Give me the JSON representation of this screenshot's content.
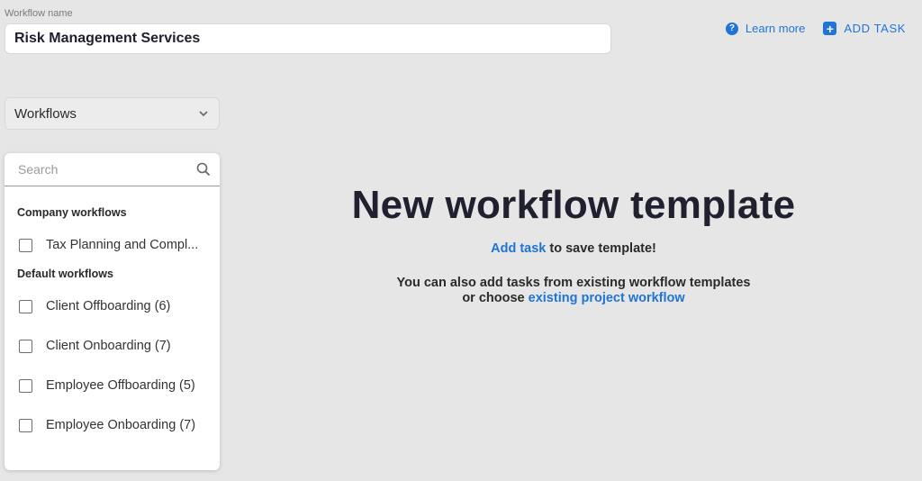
{
  "workflow": {
    "label": "Workflow name",
    "value": "Risk Management Services"
  },
  "actions": {
    "learn_more": "Learn more",
    "add_task": "ADD TASK"
  },
  "dropdown": {
    "selected": "Workflows"
  },
  "search": {
    "placeholder": "Search"
  },
  "groups": {
    "company": {
      "title": "Company workflows",
      "items": [
        "Tax Planning and Compl..."
      ]
    },
    "default": {
      "title": "Default workflows",
      "items": [
        "Client Offboarding (6)",
        "Client Onboarding (7)",
        "Employee Offboarding (5)",
        "Employee Onboarding (7)"
      ]
    }
  },
  "empty_state": {
    "title": "New workflow template",
    "add_task_link": "Add task",
    "add_task_suffix": " to save template!",
    "line2": "You can also add tasks from existing workflow templates",
    "line3_prefix": "or choose ",
    "line3_link": "existing project workflow"
  },
  "colors": {
    "accent": "#1f74d6",
    "background": "#e6e6e6"
  },
  "icons": [
    "help-circle-icon",
    "plus-square-icon",
    "chevron-down-icon",
    "search-icon"
  ]
}
